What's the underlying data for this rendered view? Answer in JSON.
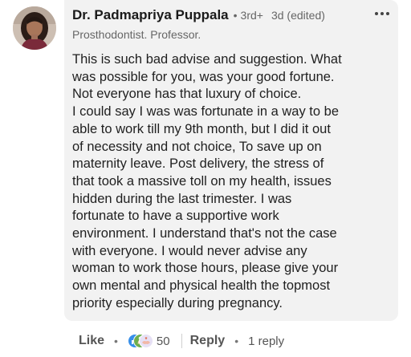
{
  "comment": {
    "author": {
      "name": "Dr. Padmapriya Puppala",
      "degree": "3rd+",
      "headline": "Prosthodontist. Professor."
    },
    "timestamp": "3d (edited)",
    "more_icon": "more-horizontal-icon",
    "body_lines": [
      "This is such bad advise and suggestion. What",
      "was possible for you, was your good fortune.",
      "Not everyone has that luxury of choice.",
      "I could say I was was fortunate in a way to be",
      "able to work till my 9th month, but I did it out",
      "of necessity and not choice, To save up on",
      "maternity leave. Post delivery, the stress of",
      "that took a massive toll on my health, issues",
      "hidden during the last trimester. I was",
      "fortunate to have a supportive work",
      "environment. I understand that's not the case",
      "with everyone. I  would never advise any",
      "woman to work those hours, please give your",
      "own mental and physical health the topmost",
      "priority especially during pregnancy."
    ]
  },
  "actions": {
    "like_label": "Like",
    "reaction_icons": [
      "like-reaction-icon",
      "celebrate-reaction-icon",
      "support-reaction-icon"
    ],
    "reaction_count": "50",
    "reply_label": "Reply",
    "reply_count": "1 reply"
  },
  "colors": {
    "bubble_bg": "#f2f2f2",
    "secondary_text": "#666666",
    "like_blue": "#378fe9",
    "celebrate_green": "#44712e",
    "support_purple": "#a872e8"
  }
}
